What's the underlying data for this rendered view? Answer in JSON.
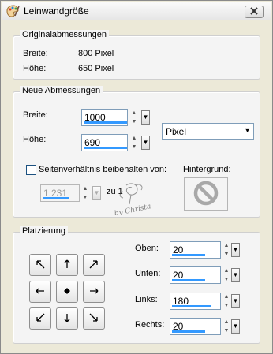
{
  "window": {
    "title": "Leinwandgröße",
    "icon": "paint-palette-icon",
    "close_icon": "close-x-icon"
  },
  "original": {
    "group_label": "Originalabmessungen",
    "width_label": "Breite:",
    "width_value": "800 Pixel",
    "height_label": "Höhe:",
    "height_value": "650 Pixel"
  },
  "new_dims": {
    "group_label": "Neue Abmessungen",
    "width_label": "Breite:",
    "width_value": "1000",
    "height_label": "Höhe:",
    "height_value": "690",
    "unit_selected": "Pixel",
    "keep_ratio_label": "Seitenverhältnis beibehalten von:",
    "keep_ratio_checked": false,
    "ratio_value": "1,231",
    "ratio_suffix": "zu 1",
    "background_label": "Hintergrund:",
    "background_icon": "no-symbol-icon"
  },
  "watermark": "by Christa",
  "placement": {
    "group_label": "Platzierung",
    "buttons": [
      "arrow-up-left-icon",
      "arrow-up-icon",
      "arrow-up-right-icon",
      "arrow-left-icon",
      "center-dot-icon",
      "arrow-right-icon",
      "arrow-down-left-icon",
      "arrow-down-icon",
      "arrow-down-right-icon"
    ],
    "top_label": "Oben:",
    "top_value": "20",
    "bottom_label": "Unten:",
    "bottom_value": "20",
    "left_label": "Links:",
    "left_value": "180",
    "right_label": "Rechts:",
    "right_value": "20"
  },
  "colors": {
    "accent": "#3399ff",
    "field_border": "#7f9db9",
    "dialog_bg": "#ece9d8",
    "group_bg": "#f4f4f4"
  }
}
